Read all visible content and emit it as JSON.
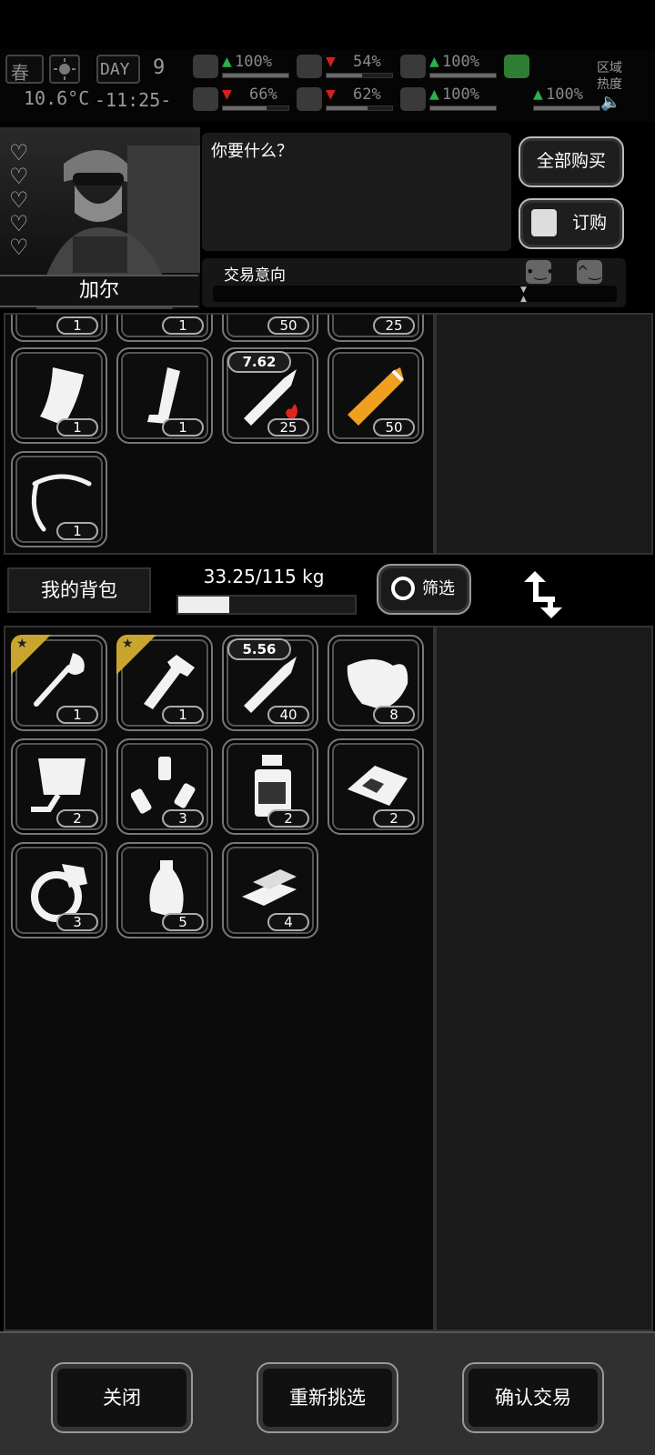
{
  "hud": {
    "season": "春",
    "day_label": "DAY",
    "day_number": "9",
    "temperature": "10.6°C",
    "clock": "-11:25-",
    "zone_label": "区域\n热度",
    "stats": [
      {
        "icon": "medkit-icon",
        "arrow": "up",
        "value": "100%",
        "level": 1.0
      },
      {
        "icon": "stomach-icon",
        "arrow": "down",
        "value": "54%",
        "level": 0.54
      },
      {
        "icon": "gasmask-icon",
        "arrow": "up",
        "value": "100%",
        "level": 1.0
      },
      {
        "icon": "brain-icon",
        "arrow": "down",
        "value": "66%",
        "level": 0.66
      },
      {
        "icon": "water-drop-icon",
        "arrow": "down",
        "value": "62%",
        "level": 0.62
      },
      {
        "icon": "heart-icon",
        "arrow": "up",
        "value": "100%",
        "level": 1.0
      },
      {
        "icon": "stamina-icon",
        "arrow": "up",
        "value": "100%",
        "level": 1.0
      }
    ]
  },
  "trader": {
    "name": "加尔",
    "hearts": 5,
    "dialog": "你要什么？",
    "buy_all_label": "全部购买",
    "order_label": "订购",
    "intent_label": "交易意向"
  },
  "trader_items": [
    {
      "icon": "weapon-part-icon",
      "count": "1"
    },
    {
      "icon": "unknown-item-icon",
      "count": "1"
    },
    {
      "icon": "ammo-round-icon",
      "count": "50"
    },
    {
      "icon": "ammo-round-icon",
      "count": "25"
    },
    {
      "icon": "rifle-magazine-icon",
      "count": "1"
    },
    {
      "icon": "pistol-magazine-icon",
      "count": "1"
    },
    {
      "icon": "incendiary-bullet-icon",
      "count": "25",
      "caliber": "7.62"
    },
    {
      "icon": "shotgun-shell-icon",
      "count": "50"
    },
    {
      "icon": "wire-icon",
      "count": "1"
    }
  ],
  "backpack": {
    "label": "我的背包",
    "weight": "33.25/115 kg",
    "weight_fraction": 0.289,
    "filter_label": "筛选",
    "items": [
      {
        "icon": "shovel-icon",
        "count": "1",
        "starred": true
      },
      {
        "icon": "multitool-icon",
        "count": "1",
        "starred": true
      },
      {
        "icon": "bullet-icon",
        "count": "40",
        "caliber": "5.56"
      },
      {
        "icon": "cloth-icon",
        "count": "8"
      },
      {
        "icon": "lamp-icon",
        "count": "2"
      },
      {
        "icon": "batteries-icon",
        "count": "3"
      },
      {
        "icon": "bottle-icon",
        "count": "2"
      },
      {
        "icon": "scrap-icon",
        "count": "2"
      },
      {
        "icon": "ring-icon",
        "count": "3"
      },
      {
        "icon": "vase-icon",
        "count": "5"
      },
      {
        "icon": "gold-bars-icon",
        "count": "4"
      }
    ]
  },
  "footer": {
    "close_label": "关闭",
    "reselect_label": "重新挑选",
    "confirm_label": "确认交易"
  },
  "colors": {
    "star_badge": "#c9a530",
    "incendiary": "#e0261c",
    "shotgun_shell": "#f0a020"
  }
}
